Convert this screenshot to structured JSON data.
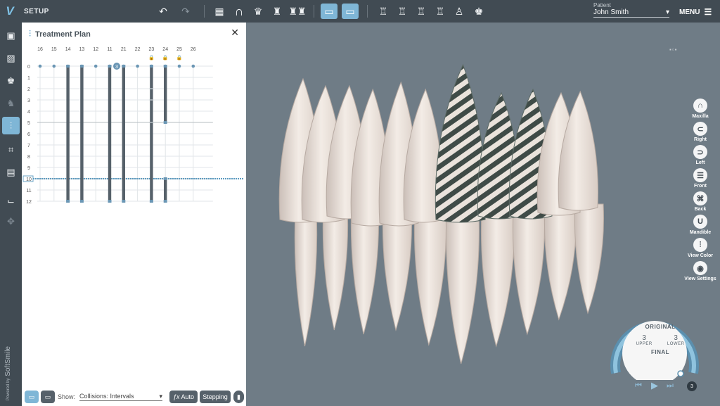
{
  "app": {
    "logo": "V",
    "section": "SETUP"
  },
  "toolbar": {
    "undo_icon": "undo-icon",
    "redo_icon": "redo-icon",
    "tools": [
      "grid-icon",
      "arch-icon",
      "tooth-crown-icon",
      "tooth-pair-icon",
      "teeth-group-icon",
      "upper-jaw-icon",
      "lower-jaw-icon",
      "tooth-1-icon",
      "tooth-2-icon",
      "tooth-3-icon",
      "tooth-4-icon",
      "tooth-5-icon",
      "tooth-6-icon"
    ]
  },
  "patient": {
    "label": "Patient",
    "name": "John Smith"
  },
  "menu": {
    "label": "MENU"
  },
  "treatment_plan": {
    "title": "Treatment Plan",
    "teeth": [
      "16",
      "15",
      "14",
      "13",
      "12",
      "11",
      "21",
      "22",
      "23",
      "24",
      "25",
      "26"
    ],
    "stages": [
      "0",
      "1",
      "2",
      "3",
      "4",
      "5",
      "6",
      "7",
      "8",
      "9",
      "10",
      "11",
      "12"
    ],
    "current_stage": "10",
    "marker_label": "3",
    "locked_teeth": [
      "23",
      "24",
      "25"
    ],
    "bars": [
      {
        "tooth": "14",
        "from": 0,
        "to": 12
      },
      {
        "tooth": "13",
        "from": 0,
        "to": 12
      },
      {
        "tooth": "11",
        "from": 0,
        "to": 12
      },
      {
        "tooth": "21",
        "from": 0,
        "to": 12
      },
      {
        "tooth": "23",
        "from": 0,
        "to": 12
      },
      {
        "tooth": "24",
        "from": 0,
        "to": 5
      },
      {
        "tooth": "24",
        "from": 10,
        "to": 12
      }
    ]
  },
  "bottom_bar": {
    "show_label": "Show:",
    "show_value": "Collisions: Intervals",
    "auto_label": "Auto",
    "stepping_label": "Stepping"
  },
  "view_tools": [
    {
      "label": "Maxilla",
      "icon": "maxilla-icon",
      "glyph": "∩"
    },
    {
      "label": "Right",
      "icon": "right-view-icon",
      "glyph": "⊂"
    },
    {
      "label": "Left",
      "icon": "left-view-icon",
      "glyph": "⊃"
    },
    {
      "label": "Front",
      "icon": "front-view-icon",
      "glyph": "☰"
    },
    {
      "label": "Back",
      "icon": "back-view-icon",
      "glyph": "⌘"
    },
    {
      "label": "Mandible",
      "icon": "mandible-icon",
      "glyph": "U"
    },
    {
      "label": "View Color",
      "icon": "view-color-icon",
      "glyph": "⫶"
    },
    {
      "label": "View Settings",
      "icon": "view-settings-icon",
      "glyph": "◉"
    }
  ],
  "stage_dial": {
    "top_label": "ORIGINAL",
    "bottom_label": "FINAL",
    "upper_value": "3",
    "upper_label": "UPPER",
    "lower_value": "3",
    "lower_label": "LOWER",
    "stage_badge": "3",
    "progress": 1.0
  },
  "branding": {
    "small": "Powered by",
    "name": "SoftSmile"
  }
}
